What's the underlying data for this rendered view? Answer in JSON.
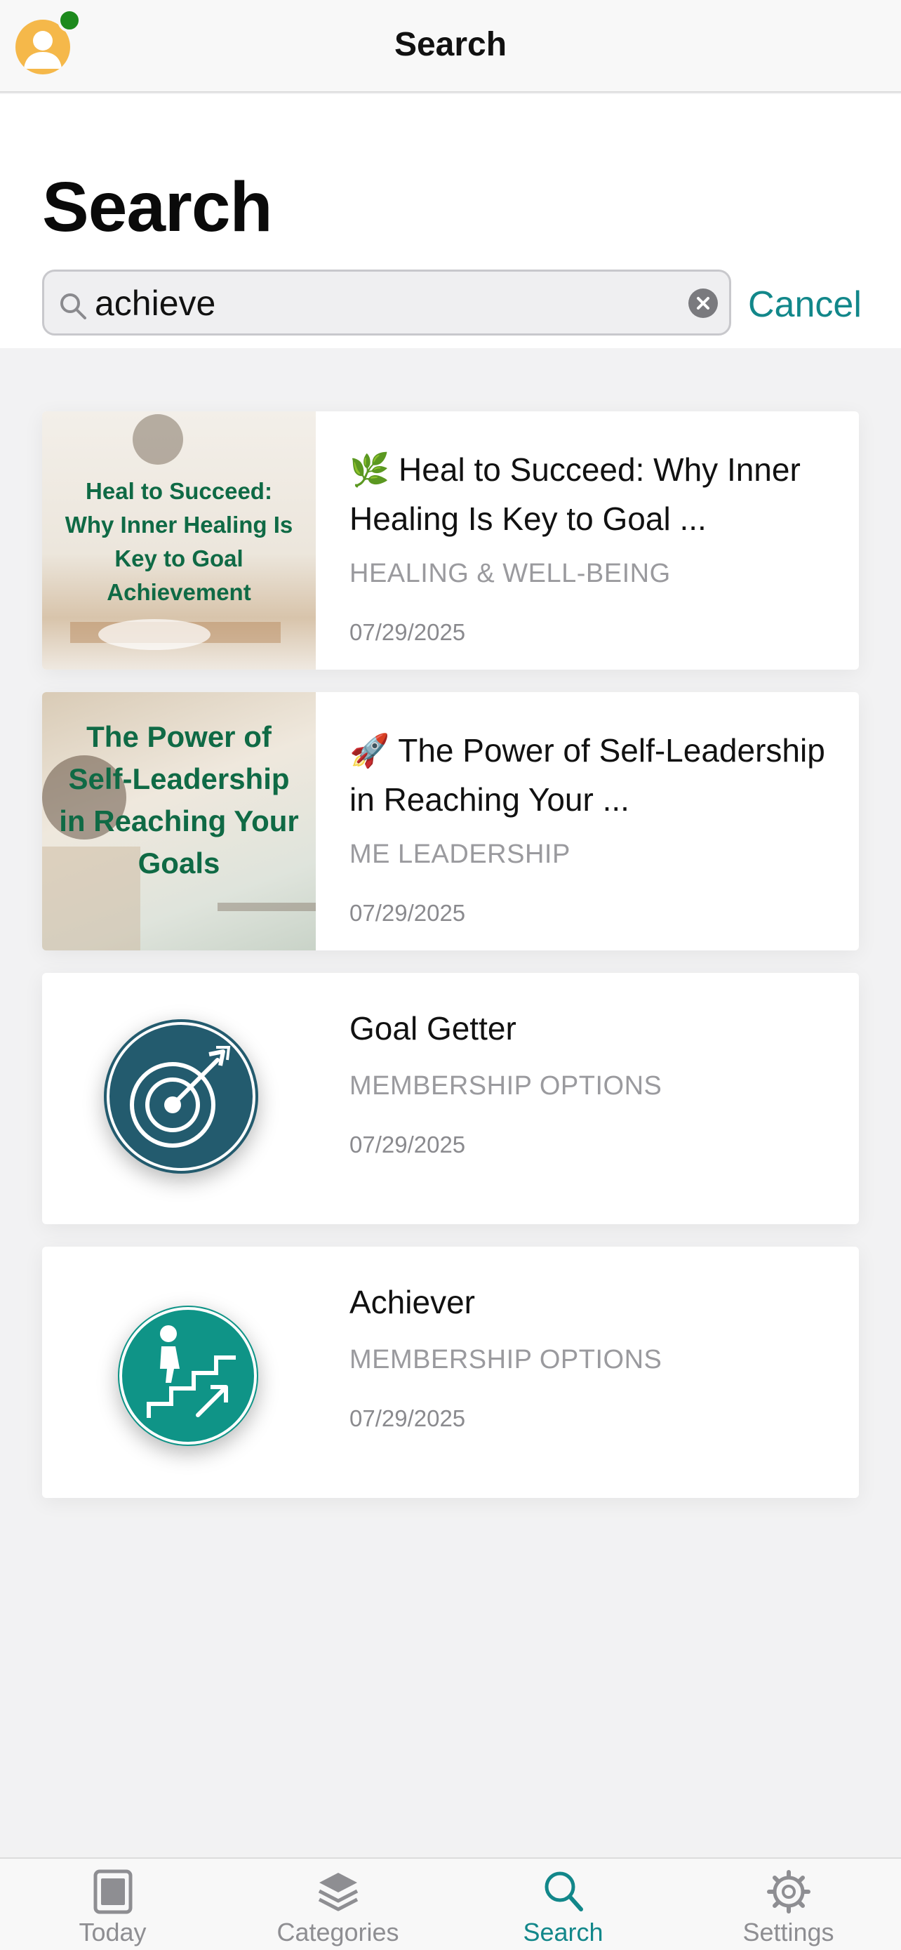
{
  "nav": {
    "title": "Search"
  },
  "page": {
    "title": "Search"
  },
  "search": {
    "value": "achieve",
    "placeholder": "Search",
    "cancel_label": "Cancel"
  },
  "results": [
    {
      "title": "🌿 Heal to Succeed: Why Inner Healing Is Key to Goal ...",
      "category": "HEALING & WELL-BEING",
      "date": "07/29/2025",
      "thumb_text": "Heal to Succeed: Why Inner Healing Is Key to Goal Achievement"
    },
    {
      "title": "🚀 The Power of Self-Leadership in Reaching Your ...",
      "category": "ME LEADERSHIP",
      "date": "07/29/2025",
      "thumb_text": "The Power of Self-Leadership in Reaching Your Goals"
    },
    {
      "title": "Goal Getter",
      "category": "MEMBERSHIP OPTIONS",
      "date": "07/29/2025",
      "icon": "target-arrow-icon",
      "icon_color": "#235b6e"
    },
    {
      "title": "Achiever",
      "category": "MEMBERSHIP OPTIONS",
      "date": "07/29/2025",
      "icon": "stairs-climb-icon",
      "icon_color": "#0f9487"
    }
  ],
  "tabs": [
    {
      "label": "Today",
      "icon": "today-icon",
      "active": false
    },
    {
      "label": "Categories",
      "icon": "layers-icon",
      "active": false
    },
    {
      "label": "Search",
      "icon": "search-icon",
      "active": true
    },
    {
      "label": "Settings",
      "icon": "gear-icon",
      "active": false
    }
  ],
  "colors": {
    "accent": "#12878a",
    "online": "#1d8a1d",
    "avatar": "#f5b84a"
  }
}
